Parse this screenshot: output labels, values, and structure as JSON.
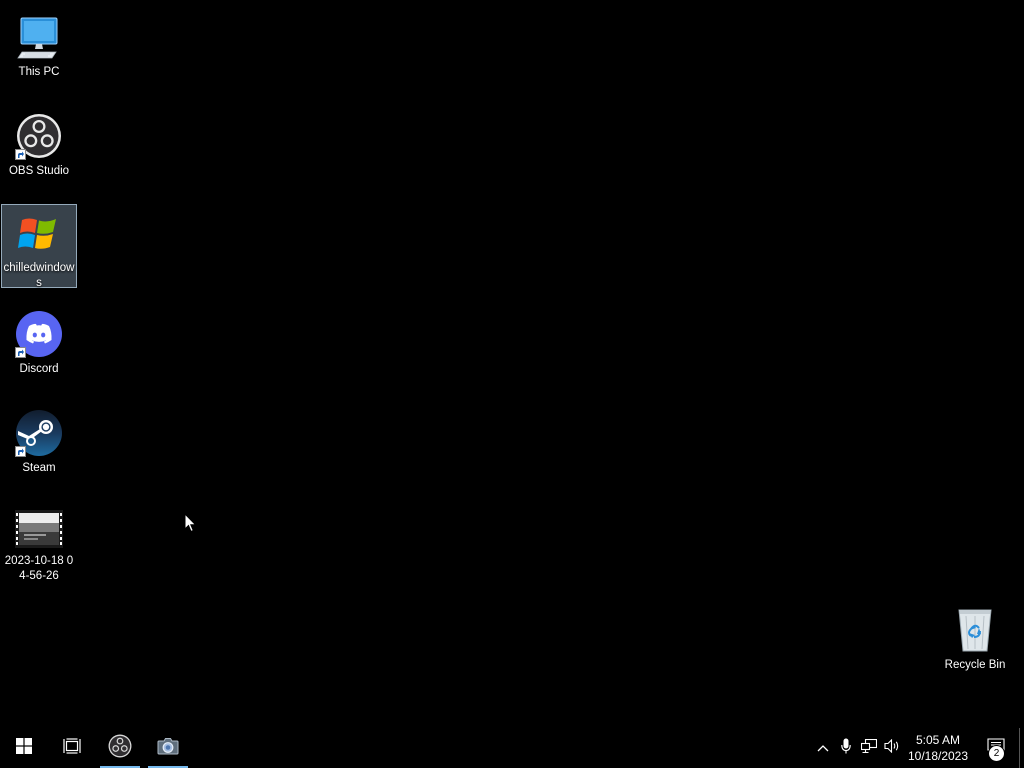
{
  "desktop": {
    "icons": [
      {
        "label": "This PC",
        "icon": "computer-icon",
        "shortcut": false,
        "selected": false
      },
      {
        "label": "OBS Studio",
        "icon": "obs-studio-icon",
        "shortcut": true,
        "selected": false
      },
      {
        "label": "chilledwindows",
        "icon": "windows-logo-icon",
        "shortcut": false,
        "selected": true
      },
      {
        "label": "Discord",
        "icon": "discord-icon",
        "shortcut": true,
        "selected": false
      },
      {
        "label": "Steam",
        "icon": "steam-icon",
        "shortcut": true,
        "selected": false
      },
      {
        "label": "2023-10-18 04-56-26",
        "icon": "video-file-icon",
        "shortcut": false,
        "selected": false
      },
      {
        "label": "Recycle Bin",
        "icon": "recycle-bin-icon",
        "shortcut": false,
        "selected": false
      }
    ]
  },
  "taskbar": {
    "pinned": [
      {
        "name": "start-button",
        "icon": "windows-start-icon",
        "running": false
      },
      {
        "name": "task-view-button",
        "icon": "task-view-icon",
        "running": false
      },
      {
        "name": "taskbar-obs-studio",
        "icon": "obs-studio-icon",
        "running": true
      },
      {
        "name": "taskbar-camera",
        "icon": "camera-icon",
        "running": true
      }
    ],
    "tray": {
      "icons": [
        "chevron-up-icon",
        "microphone-icon",
        "network-icon",
        "volume-icon"
      ],
      "time": "5:05 AM",
      "date": "10/18/2023",
      "notification_count": "2"
    }
  },
  "colors": {
    "accent": "#76b9ed",
    "discord": "#5865f2",
    "background": "#000000"
  }
}
